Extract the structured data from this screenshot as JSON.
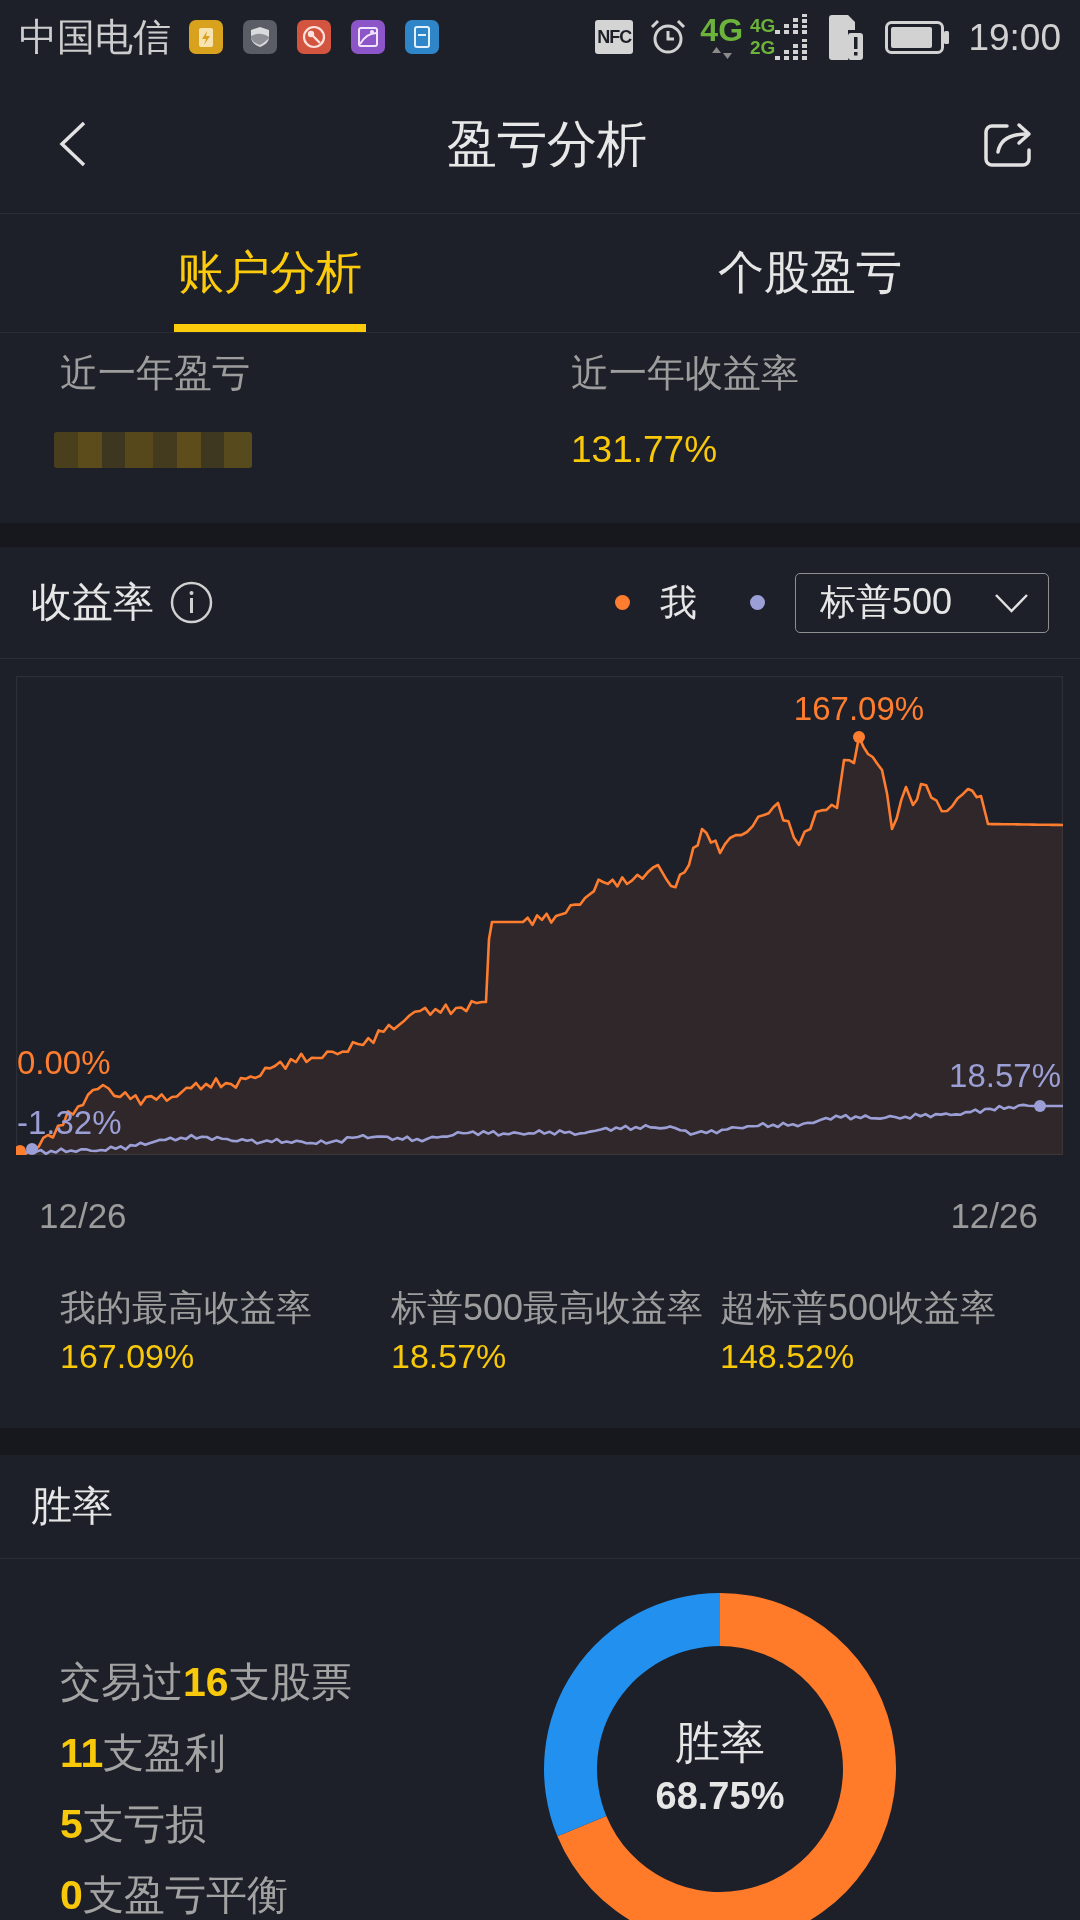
{
  "status_bar": {
    "carrier": "中国电信",
    "nfc": "NFC",
    "network": "4G",
    "sim2_networks": [
      "4G",
      "2G"
    ],
    "time": "19:00"
  },
  "header": {
    "title": "盈亏分析"
  },
  "tabs": [
    {
      "label": "账户分析",
      "selected": true
    },
    {
      "label": "个股盈亏",
      "selected": false
    }
  ],
  "summary": [
    {
      "label": "近一年盈亏",
      "redacted": true
    },
    {
      "label": "近一年收益率",
      "value": "131.77%"
    }
  ],
  "returns": {
    "title": "收益率",
    "series": [
      {
        "label": "我",
        "color": "#ff7d2e",
        "start_label": "0.00%",
        "peak_label": "167.09%"
      },
      {
        "selector": "标普500",
        "color": "#9c9fd6",
        "start_label": "-1.32%",
        "end_label": "18.57%"
      }
    ],
    "x_labels": [
      "12/26",
      "12/26"
    ],
    "stats": [
      {
        "label": "我的最高收益率",
        "value": "167.09%"
      },
      {
        "label": "标普500最高收益率",
        "value": "18.57%"
      },
      {
        "label": "超标普500收益率",
        "value": "148.52%"
      }
    ]
  },
  "win_rate": {
    "title": "胜率",
    "lines": [
      "交易过**16**支股票",
      "**11**支盈利",
      "**5**支亏损",
      "**0**支盈亏平衡"
    ],
    "ring": {
      "label": "胜率",
      "value": "68.75%"
    },
    "chart_data": {
      "type": "donut",
      "values": [
        68.75,
        31.25
      ]
    }
  }
}
